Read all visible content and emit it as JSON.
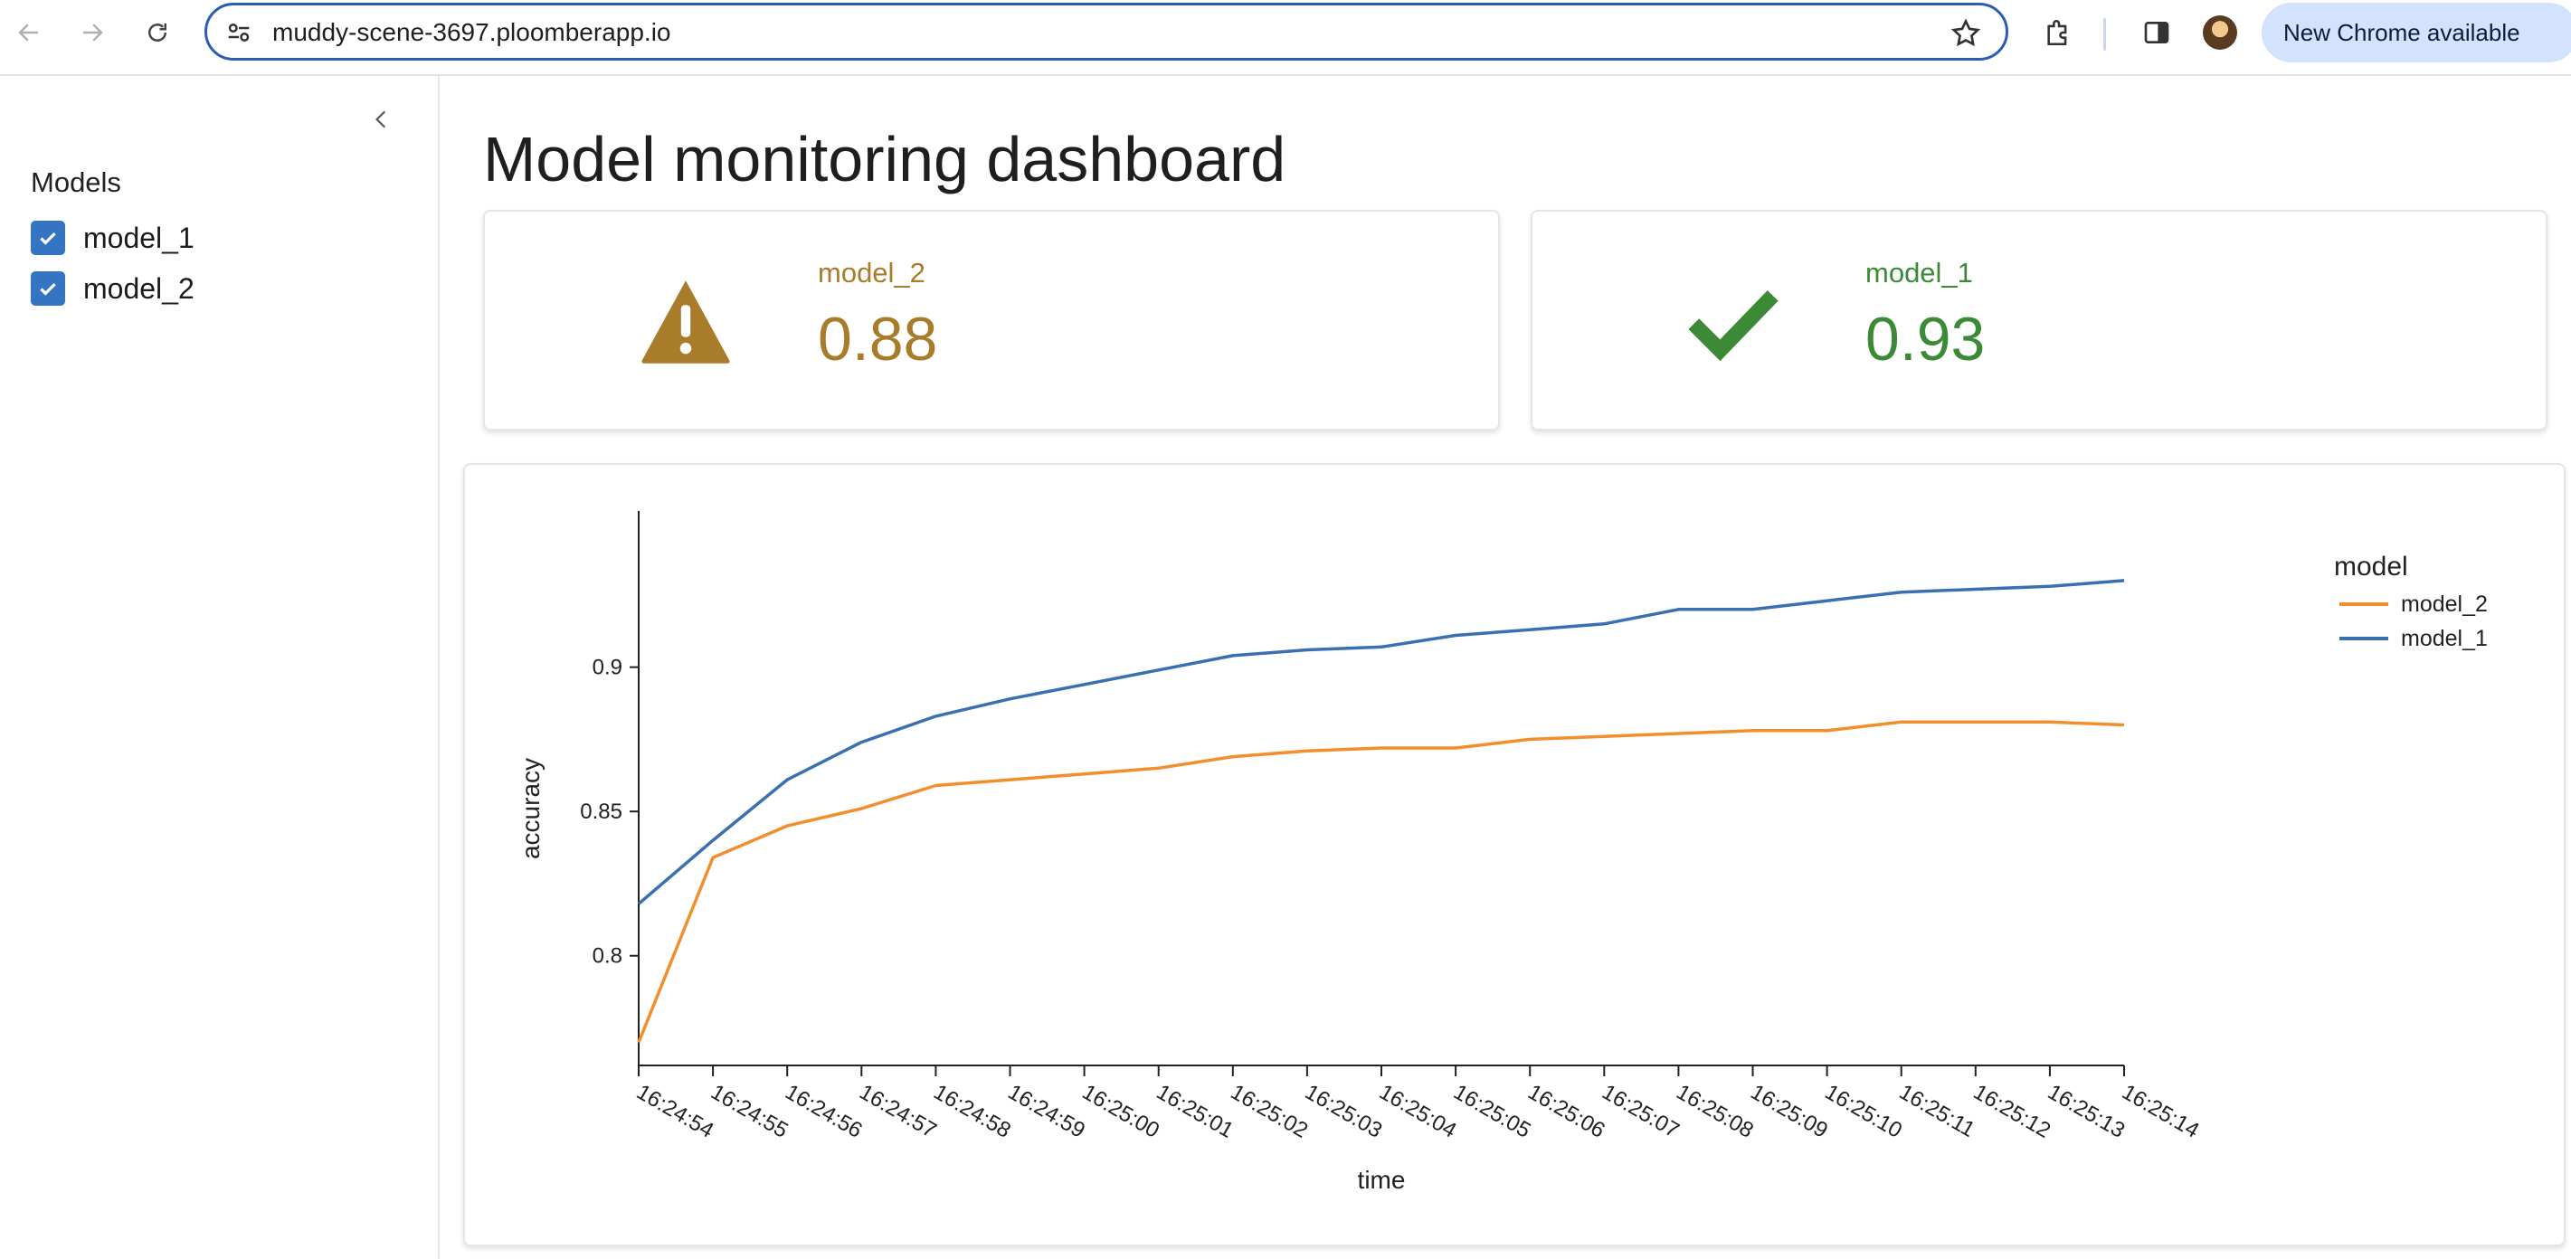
{
  "browser": {
    "url": "muddy-scene-3697.ploomberapp.io",
    "update_label": "New Chrome available"
  },
  "sidebar": {
    "heading": "Models",
    "items": [
      {
        "label": "model_1",
        "checked": true
      },
      {
        "label": "model_2",
        "checked": true
      }
    ]
  },
  "main": {
    "title": "Model monitoring dashboard",
    "cards": [
      {
        "model": "model_2",
        "value": "0.88",
        "status": "warning",
        "icon": "warning-icon",
        "color": "#a87c2b"
      },
      {
        "model": "model_1",
        "value": "0.93",
        "status": "ok",
        "icon": "check-icon",
        "color": "#3c8a36"
      }
    ]
  },
  "chart_data": {
    "type": "line",
    "xlabel": "time",
    "ylabel": "accuracy",
    "ylim": [
      0.762,
      0.94
    ],
    "yticks": [
      0.8,
      0.85,
      0.9
    ],
    "ytick_labels": [
      "0.8",
      "0.85",
      "0.9"
    ],
    "categories": [
      "16:24:54",
      "16:24:55",
      "16:24:56",
      "16:24:57",
      "16:24:58",
      "16:24:59",
      "16:25:00",
      "16:25:01",
      "16:25:02",
      "16:25:03",
      "16:25:04",
      "16:25:05",
      "16:25:06",
      "16:25:07",
      "16:25:08",
      "16:25:09",
      "16:25:10",
      "16:25:11",
      "16:25:12",
      "16:25:13",
      "16:25:14"
    ],
    "legend_title": "model",
    "legend_position": "top-right",
    "grid": false,
    "series": [
      {
        "name": "model_2",
        "color": "#f28e2b",
        "values": [
          0.77,
          0.834,
          0.845,
          0.851,
          0.859,
          0.861,
          0.863,
          0.865,
          0.869,
          0.871,
          0.872,
          0.872,
          0.875,
          0.876,
          0.877,
          0.878,
          0.878,
          0.881,
          0.881,
          0.881,
          0.88
        ]
      },
      {
        "name": "model_1",
        "color": "#3a6fb0",
        "values": [
          0.818,
          0.84,
          0.861,
          0.874,
          0.883,
          0.889,
          0.894,
          0.899,
          0.904,
          0.906,
          0.907,
          0.911,
          0.913,
          0.915,
          0.92,
          0.92,
          0.923,
          0.926,
          0.927,
          0.928,
          0.93
        ]
      }
    ]
  }
}
